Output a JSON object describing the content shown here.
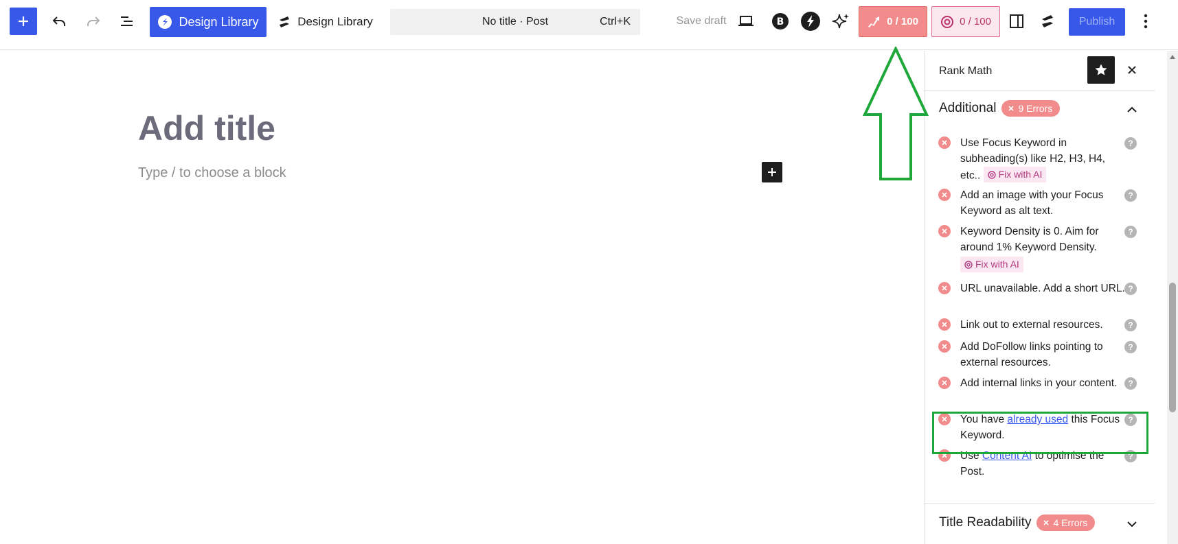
{
  "toolbar": {
    "design_library_primary": "Design Library",
    "design_library_secondary": "Design Library",
    "command_title": "No title · Post",
    "command_shortcut": "Ctrl+K",
    "save_draft": "Save draft",
    "rank_math_score": "0 / 100",
    "content_ai_score": "0 / 100",
    "publish": "Publish"
  },
  "editor": {
    "title_placeholder": "Add title",
    "block_placeholder": "Type / to choose a block"
  },
  "sidebar": {
    "title": "Rank Math",
    "additional": {
      "label": "Additional",
      "errors_badge": "9 Errors",
      "checks": [
        {
          "text": "Use Focus Keyword in subheading(s) like H2, H3, H4, etc..",
          "fix": "Fix with AI"
        },
        {
          "text": "Add an image with your Focus Keyword as alt text."
        },
        {
          "text": "Keyword Density is 0. Aim for around 1% Keyword Density.",
          "fix": "Fix with AI"
        },
        {
          "text": "URL unavailable. Add a short URL."
        },
        {
          "text": "Link out to external resources."
        },
        {
          "text": "Add DoFollow links pointing to external resources."
        },
        {
          "text": "Add internal links in your content."
        },
        {
          "pre": "You have ",
          "link": "already used",
          "post": " this Focus Keyword."
        },
        {
          "pre": "Use ",
          "link": "Content AI",
          "post": " to optimise the Post."
        }
      ]
    },
    "title_readability": {
      "label": "Title Readability",
      "errors_badge": "4 Errors"
    }
  },
  "colors": {
    "accent": "#3858e9",
    "error": "#f28b8b",
    "annotation": "#1fa83a"
  }
}
